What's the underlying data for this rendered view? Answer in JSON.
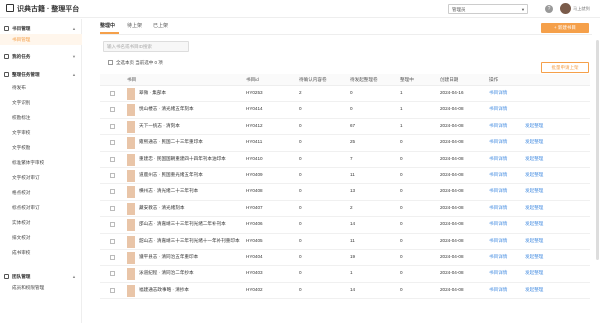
{
  "app": {
    "title": "识典古籍 · 整理平台"
  },
  "header": {
    "role": "管理员",
    "help": "?",
    "username": "马上就到"
  },
  "sidebar": {
    "groups": [
      {
        "label": "书目管理",
        "items": [
          "书目管理"
        ]
      },
      {
        "label": "我的任务",
        "items": []
      },
      {
        "label": "整理任务管理",
        "items": [
          "待发布",
          "文字识别",
          "校勘标注",
          "文字审校",
          "文字校勘",
          "标准繁体字审校",
          "文字校对审订",
          "格点校对",
          "标点校对审订",
          "实体校对",
          "排文校对",
          "成书审校"
        ]
      },
      {
        "label": "团队管理",
        "items": [
          "成员和权限管理"
        ]
      }
    ]
  },
  "tabs": [
    "整理中",
    "待上架",
    "已上架"
  ],
  "buttons": {
    "new_book": "+ 新建书目",
    "batch": "批量申请上架"
  },
  "search": {
    "placeholder": "输入书名或书目ID搜索"
  },
  "select_all": {
    "label": "全选本页  当前选中 0 项"
  },
  "table": {
    "headers": [
      "书目",
      "书目id",
      "待确认内容卷",
      "待发起整理卷",
      "整理中",
      "创建日期",
      "操作"
    ],
    "rows": [
      [
        "翠微 · 集部本",
        "HY0253",
        "2",
        "0",
        "1",
        "2024-04-16",
        "书目详情",
        ""
      ],
      [
        "悦山楼志 · 清光绪五年刻本",
        "HY0414",
        "0",
        "0",
        "1",
        "2024-04-08",
        "书目详情",
        ""
      ],
      [
        "天下一统志 · 清刻本",
        "HY0412",
        "0",
        "67",
        "1",
        "2024-04-08",
        "书目详情",
        "发起整理"
      ],
      [
        "雍熙通志 · 民国二十三年重印本",
        "HY0411",
        "0",
        "25",
        "0",
        "2024-04-08",
        "书目详情",
        "发起整理"
      ],
      [
        "重建忠 · 民国国朝重建四十四年刊本油印本",
        "HY0410",
        "0",
        "7",
        "0",
        "2024-04-08",
        "书目详情",
        "发起整理"
      ],
      [
        "道鹿州志 · 民国重光绪五年刊本",
        "HY0409",
        "0",
        "11",
        "0",
        "2024-04-08",
        "书目详情",
        "发起整理"
      ],
      [
        "横州志 · 清光绪二十三年刊本",
        "HY0408",
        "0",
        "13",
        "0",
        "2024-04-08",
        "书目详情",
        "发起整理"
      ],
      [
        "藏安教志 · 清光绪刻本",
        "HY0407",
        "0",
        "2",
        "0",
        "2024-04-08",
        "书目详情",
        "发起整理"
      ],
      [
        "邵山志 · 清嘉靖三十三年刊光绪二年补刊本",
        "HY0406",
        "0",
        "14",
        "0",
        "2024-04-08",
        "书目详情",
        "发起整理"
      ],
      [
        "韶山志 · 清嘉靖三十三年刊光绪十一年补刊重印本",
        "HY0405",
        "0",
        "11",
        "0",
        "2024-04-08",
        "书目详情",
        "发起整理"
      ],
      [
        "遵平县志 · 清同治五年重印本",
        "HY0404",
        "0",
        "19",
        "0",
        "2024-04-08",
        "书目详情",
        "发起整理"
      ],
      [
        "泳道纪程 · 清同治二年抄本",
        "HY0403",
        "0",
        "1",
        "0",
        "2024-04-08",
        "书目详情",
        "发起整理"
      ],
      [
        "福建通志政事略 · 清抄本",
        "HY0402",
        "0",
        "14",
        "0",
        "2024-04-08",
        "书目详情",
        "发起整理"
      ]
    ]
  },
  "colors": {
    "accent": "#f5a04a",
    "link": "#4a90e2"
  }
}
